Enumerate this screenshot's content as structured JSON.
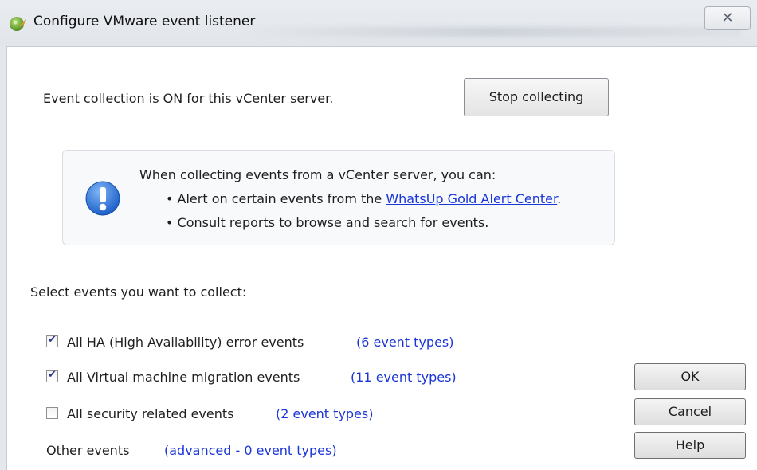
{
  "window": {
    "title": "Configure VMware event listener",
    "close_glyph": "✕"
  },
  "status": {
    "text": "Event collection is ON for this vCenter server.",
    "stop_button": "Stop collecting"
  },
  "info": {
    "icon": "exclamation-icon",
    "line1": "When collecting events from a vCenter server, you can:",
    "line2_prefix": "• Alert on certain events from the ",
    "line2_link": "WhatsUp Gold Alert Center",
    "line2_suffix": ".",
    "line3": "• Consult reports to browse and search for events."
  },
  "events": {
    "section_label": "Select events you want to collect:",
    "items": [
      {
        "label": "All HA (High Availability) error events",
        "count": "(6 event types)",
        "checked": true
      },
      {
        "label": "All Virtual machine migration events",
        "count": "(11 event types)",
        "checked": true
      },
      {
        "label": "All security related events",
        "count": "(2 event types)",
        "checked": false
      }
    ],
    "other_label": "Other events",
    "other_count": "(advanced - 0 event types)"
  },
  "buttons": {
    "ok": "OK",
    "cancel": "Cancel",
    "help": "Help"
  },
  "colors": {
    "link": "#1a35d8",
    "info_icon": "#2a6fd6"
  }
}
